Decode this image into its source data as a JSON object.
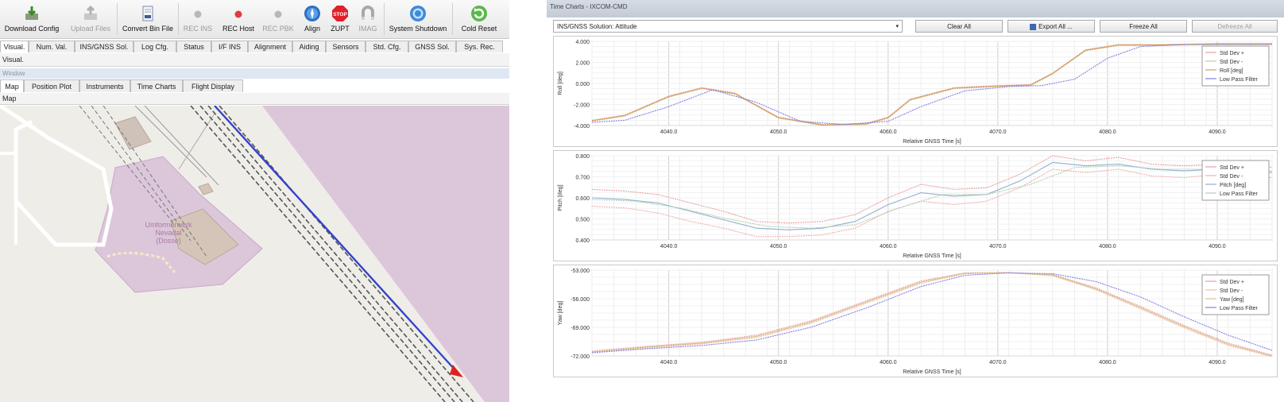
{
  "toolbar": {
    "buttons": [
      {
        "label": "Download Config",
        "icon": "download-icon"
      },
      {
        "label": "Upload Files",
        "icon": "upload-icon"
      },
      {
        "label": "Convert Bin File",
        "icon": "file-icon"
      },
      {
        "label": "REC INS",
        "icon": "record-dot-icon"
      },
      {
        "label": "REC Host",
        "icon": "record-dot-icon"
      },
      {
        "label": "REC PBK",
        "icon": "record-dot-icon"
      },
      {
        "label": "Align",
        "icon": "compass-icon"
      },
      {
        "label": "ZUPT",
        "icon": "stop-sign-icon",
        "icon_text": "STOP"
      },
      {
        "label": "IMAG",
        "icon": "magnet-icon"
      },
      {
        "label": "System Shutdown",
        "icon": "power-icon"
      },
      {
        "label": "Cold Reset",
        "icon": "refresh-icon"
      }
    ]
  },
  "main_tabs": [
    "Visual.",
    "Num. Val.",
    "INS/GNSS Sol.",
    "Log Cfg.",
    "Status",
    "I/F INS",
    "Alignment",
    "Aiding",
    "Sensors",
    "Std. Cfg.",
    "GNSS Sol.",
    "Sys. Rec."
  ],
  "active_main_tab": "Visual.",
  "sub_header": "Visual.",
  "window_label": "Window",
  "view_tabs": [
    "Map",
    "Position Plot",
    "Instruments",
    "Time Charts",
    "Flight Display"
  ],
  "active_view_tab": "Map",
  "map_header": "Map",
  "map": {
    "label_line1": "Umformerwerk",
    "label_line2": "Nevadal",
    "label_line3": "(Dosse)"
  },
  "time_chart": {
    "window_title": "Time Charts - IXCOM-CMD",
    "selector": "INS/GNSS Solution: Attitude",
    "buttons": {
      "clear_all": "Clear All",
      "export_all": "Export All ...",
      "freeze_all": "Freeze All",
      "defreeze_all": "Defreeze All"
    }
  },
  "chart_data": [
    {
      "type": "line",
      "ylabel": "Roll [deg]",
      "xlabel": "Relative GNSS Time [s]",
      "xlim": [
        4033,
        4095
      ],
      "ylim": [
        -4.0,
        4.0
      ],
      "x_ticks": [
        "4040.0",
        "4050.0",
        "4060.0",
        "4070.0",
        "4080.0",
        "4090.0"
      ],
      "y_ticks": [
        "4.000",
        "2.000",
        "0.000",
        "-2.000",
        "-4.000"
      ],
      "legend": [
        "Std Dev +",
        "Std Dev -",
        "Roll [deg]",
        "Low Pass Filter"
      ],
      "grid": true,
      "legend_position": "top-right",
      "series": [
        {
          "name": "Std Dev +",
          "color": "#e8a0a0",
          "x": [
            4033,
            4036,
            4040,
            4043,
            4046,
            4050,
            4054,
            4058,
            4060,
            4062,
            4066,
            4070,
            4073,
            4075,
            4078,
            4081,
            4085,
            4090,
            4095
          ],
          "y": [
            -3.5,
            -3.0,
            -1.2,
            -0.4,
            -0.9,
            -3.2,
            -3.9,
            -3.8,
            -3.2,
            -1.5,
            -0.4,
            -0.2,
            -0.1,
            1.0,
            3.2,
            3.7,
            3.7,
            3.8,
            3.8
          ]
        },
        {
          "name": "Std Dev -",
          "color": "#c8c8a0",
          "x": [
            4033,
            4036,
            4040,
            4043,
            4046,
            4050,
            4054,
            4058,
            4060,
            4062,
            4066,
            4070,
            4073,
            4075,
            4078,
            4081,
            4085,
            4090,
            4095
          ],
          "y": [
            -3.6,
            -3.1,
            -1.3,
            -0.5,
            -1.0,
            -3.3,
            -4.0,
            -3.9,
            -3.3,
            -1.6,
            -0.5,
            -0.3,
            -0.2,
            0.9,
            3.1,
            3.6,
            3.6,
            3.7,
            3.7
          ]
        },
        {
          "name": "Roll [deg]",
          "color": "#d6a060",
          "x": [
            4033,
            4036,
            4040,
            4043,
            4046,
            4050,
            4054,
            4058,
            4060,
            4062,
            4066,
            4070,
            4073,
            4075,
            4078,
            4081,
            4085,
            4090,
            4095
          ],
          "y": [
            -3.55,
            -3.05,
            -1.25,
            -0.45,
            -0.95,
            -3.25,
            -3.95,
            -3.85,
            -3.25,
            -1.55,
            -0.45,
            -0.25,
            -0.15,
            0.95,
            3.15,
            3.65,
            3.65,
            3.75,
            3.75
          ]
        },
        {
          "name": "Low Pass Filter",
          "color": "#8080e0",
          "x": [
            4033,
            4036,
            4040,
            4044,
            4048,
            4052,
            4056,
            4060,
            4063,
            4067,
            4071,
            4074,
            4077,
            4080,
            4083,
            4087,
            4091,
            4095
          ],
          "y": [
            -3.7,
            -3.5,
            -2.2,
            -0.6,
            -1.8,
            -3.6,
            -3.9,
            -3.6,
            -2.2,
            -0.7,
            -0.3,
            -0.2,
            0.4,
            2.4,
            3.5,
            3.7,
            3.7,
            3.7
          ]
        }
      ]
    },
    {
      "type": "line",
      "ylabel": "Pitch [deg]",
      "xlabel": "Relative GNSS Time [s]",
      "xlim": [
        4033,
        4095
      ],
      "ylim": [
        0.33,
        0.83
      ],
      "x_ticks": [
        "4040.0",
        "4050.0",
        "4060.0",
        "4070.0",
        "4080.0",
        "4090.0"
      ],
      "y_ticks": [
        "0.800",
        "0.700",
        "0.600",
        "0.500",
        "0.400"
      ],
      "legend": [
        "Std Dev +",
        "Std Dev -",
        "Pitch [deg]",
        "Low Pass Filter"
      ],
      "grid": true,
      "legend_position": "top-right",
      "series": [
        {
          "name": "Std Dev +",
          "color": "#e8a0a0",
          "x": [
            4033,
            4036,
            4039,
            4042,
            4045,
            4048,
            4051,
            4054,
            4057,
            4060,
            4063,
            4066,
            4069,
            4072,
            4075,
            4078,
            4081,
            4084,
            4087,
            4090,
            4095
          ],
          "y": [
            0.63,
            0.62,
            0.6,
            0.55,
            0.5,
            0.44,
            0.43,
            0.44,
            0.48,
            0.58,
            0.66,
            0.63,
            0.64,
            0.72,
            0.83,
            0.8,
            0.82,
            0.78,
            0.77,
            0.78,
            0.76
          ]
        },
        {
          "name": "Std Dev -",
          "color": "#f0b0b0",
          "x": [
            4033,
            4036,
            4039,
            4042,
            4045,
            4048,
            4051,
            4054,
            4057,
            4060,
            4063,
            4066,
            4069,
            4072,
            4075,
            4078,
            4081,
            4084,
            4087,
            4090,
            4095
          ],
          "y": [
            0.53,
            0.52,
            0.49,
            0.44,
            0.4,
            0.35,
            0.35,
            0.36,
            0.4,
            0.5,
            0.56,
            0.54,
            0.56,
            0.64,
            0.75,
            0.73,
            0.75,
            0.71,
            0.7,
            0.72,
            0.7
          ]
        },
        {
          "name": "Pitch [deg]",
          "color": "#90b0d0",
          "x": [
            4033,
            4036,
            4039,
            4042,
            4045,
            4048,
            4051,
            4054,
            4057,
            4060,
            4063,
            4066,
            4069,
            4072,
            4075,
            4078,
            4081,
            4084,
            4087,
            4090,
            4095
          ],
          "y": [
            0.58,
            0.57,
            0.55,
            0.5,
            0.45,
            0.4,
            0.39,
            0.4,
            0.44,
            0.54,
            0.61,
            0.59,
            0.6,
            0.68,
            0.79,
            0.77,
            0.78,
            0.75,
            0.74,
            0.75,
            0.73
          ]
        },
        {
          "name": "Low Pass Filter",
          "color": "#b0d0b0",
          "x": [
            4033,
            4037,
            4041,
            4045,
            4049,
            4053,
            4057,
            4061,
            4065,
            4069,
            4073,
            4077,
            4081,
            4085,
            4090,
            4095
          ],
          "y": [
            0.57,
            0.56,
            0.52,
            0.46,
            0.41,
            0.4,
            0.42,
            0.52,
            0.6,
            0.6,
            0.66,
            0.76,
            0.77,
            0.75,
            0.75,
            0.74
          ]
        }
      ]
    },
    {
      "type": "line",
      "ylabel": "Yaw [deg]",
      "xlabel": "Relative GNSS Time [s]",
      "xlim": [
        4033,
        4095
      ],
      "ylim": [
        -74.0,
        -52.5
      ],
      "x_ticks": [
        "4040.0",
        "4050.0",
        "4060.0",
        "4070.0",
        "4080.0",
        "4090.0"
      ],
      "y_ticks": [
        "-53.000",
        "-56.000",
        "-69.000",
        "-72.000"
      ],
      "legend": [
        "Std Dev +",
        "Std Dev -",
        "Yaw [deg]",
        "Low Pass Filter"
      ],
      "grid": true,
      "legend_position": "top-right",
      "series": [
        {
          "name": "Std Dev +",
          "color": "#e8a0a0",
          "x": [
            4033,
            4038,
            4043,
            4048,
            4053,
            4058,
            4063,
            4067,
            4071,
            4075,
            4079,
            4083,
            4087,
            4091,
            4095
          ],
          "y": [
            -72.8,
            -71.6,
            -70.6,
            -68.8,
            -65.2,
            -60.2,
            -55.2,
            -53.2,
            -53.1,
            -53.6,
            -57.0,
            -61.6,
            -66.4,
            -70.8,
            -73.8
          ]
        },
        {
          "name": "Std Dev -",
          "color": "#f0c0a0",
          "x": [
            4033,
            4038,
            4043,
            4048,
            4053,
            4058,
            4063,
            4067,
            4071,
            4075,
            4079,
            4083,
            4087,
            4091,
            4095
          ],
          "y": [
            -73.2,
            -72.0,
            -71.0,
            -69.4,
            -65.8,
            -60.8,
            -55.8,
            -53.4,
            -53.2,
            -53.9,
            -57.5,
            -62.2,
            -67.0,
            -71.4,
            -74.2
          ]
        },
        {
          "name": "Yaw [deg]",
          "color": "#d8c090",
          "x": [
            4033,
            4038,
            4043,
            4048,
            4053,
            4058,
            4063,
            4067,
            4071,
            4075,
            4079,
            4083,
            4087,
            4091,
            4095
          ],
          "y": [
            -73.0,
            -71.8,
            -70.8,
            -69.1,
            -65.5,
            -60.5,
            -55.5,
            -53.3,
            -53.15,
            -53.75,
            -57.25,
            -61.9,
            -66.7,
            -71.1,
            -74.0
          ]
        },
        {
          "name": "Low Pass Filter",
          "color": "#8080e0",
          "x": [
            4033,
            4038,
            4043,
            4048,
            4053,
            4058,
            4063,
            4067,
            4071,
            4075,
            4079,
            4083,
            4087,
            4091,
            4095
          ],
          "y": [
            -73.2,
            -72.2,
            -71.4,
            -70.0,
            -66.8,
            -62.0,
            -56.6,
            -53.8,
            -53.2,
            -53.4,
            -55.4,
            -59.2,
            -64.2,
            -68.8,
            -72.6
          ]
        }
      ]
    }
  ],
  "colors": {
    "map_background": "#efede8",
    "military_area": "#dcc7da",
    "railway": "#555555",
    "rail_route": "#3344cc",
    "position_marker": "#e02020",
    "grid": "#e2e2e2"
  }
}
